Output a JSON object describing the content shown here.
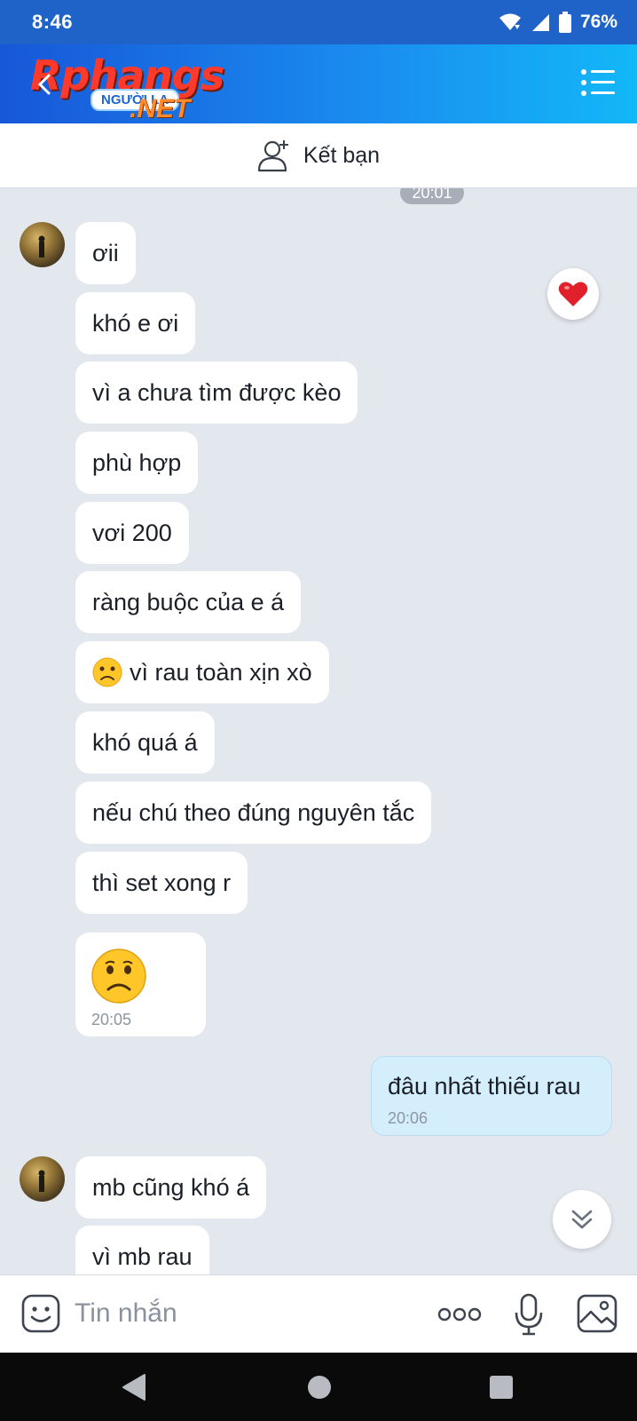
{
  "status": {
    "time": "8:46",
    "battery": "76%"
  },
  "header": {
    "watermark_main": "Rphangs",
    "watermark_sub": "NGƯỜI LẠ",
    "watermark_net": ".NET"
  },
  "friend_bar": {
    "label": "Kết bạn"
  },
  "chat": {
    "time_chip": "20:01",
    "incoming_1": [
      "ơii",
      "khó e ơi",
      "vì a chưa tìm được kèo",
      "phù hợp",
      "vơi 200",
      "ràng buộc của e á",
      "vì rau toàn xịn xò",
      "khó quá á",
      "nếu chú theo đúng nguyên tắc",
      "thì set xong r"
    ],
    "emoji_time": "20:05",
    "outgoing": {
      "text": "đâu nhất thiếu rau",
      "time": "20:06"
    },
    "incoming_2": [
      "mb cũng khó á",
      "vì mb rau"
    ]
  },
  "input": {
    "placeholder": "Tin nhắn"
  },
  "colors": {
    "header_start": "#1757d9",
    "header_end": "#12b8f7",
    "bubble_out": "#d5eefc",
    "chat_bg": "#e3e7ee"
  }
}
